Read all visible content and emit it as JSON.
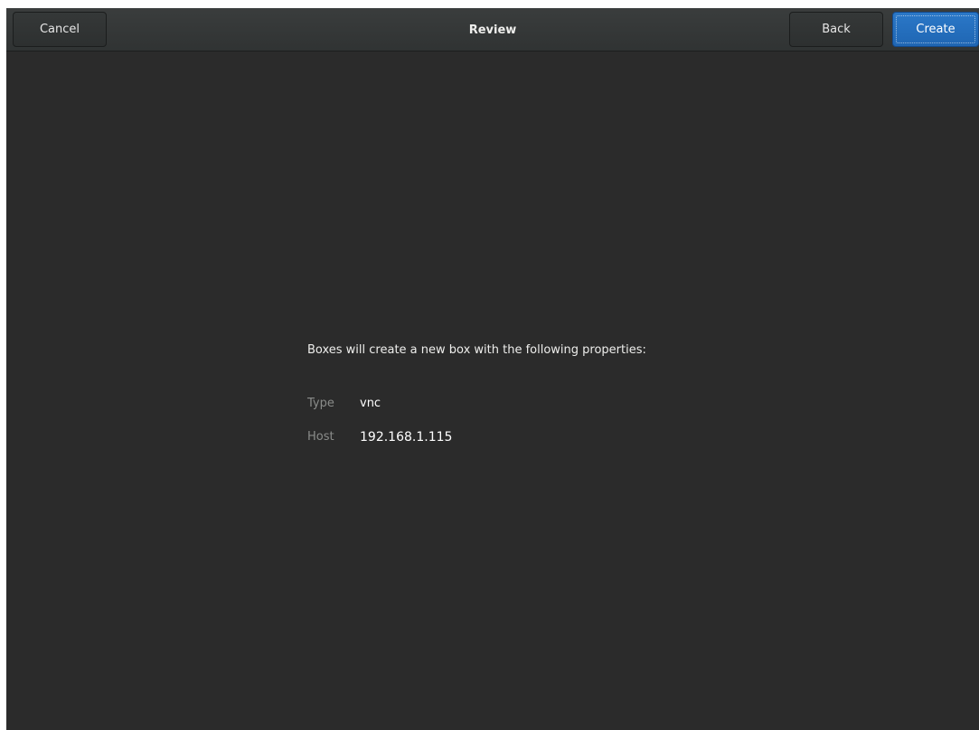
{
  "header": {
    "title": "Review",
    "cancel_label": "Cancel",
    "back_label": "Back",
    "create_label": "Create"
  },
  "review": {
    "intro": "Boxes will create a new box with the following properties:",
    "properties": [
      {
        "label": "Type",
        "value": "vnc"
      },
      {
        "label": "Host",
        "value": "192.168.1.115"
      }
    ]
  },
  "colors": {
    "background": "#2b2b2b",
    "accent": "#2b78c8"
  }
}
